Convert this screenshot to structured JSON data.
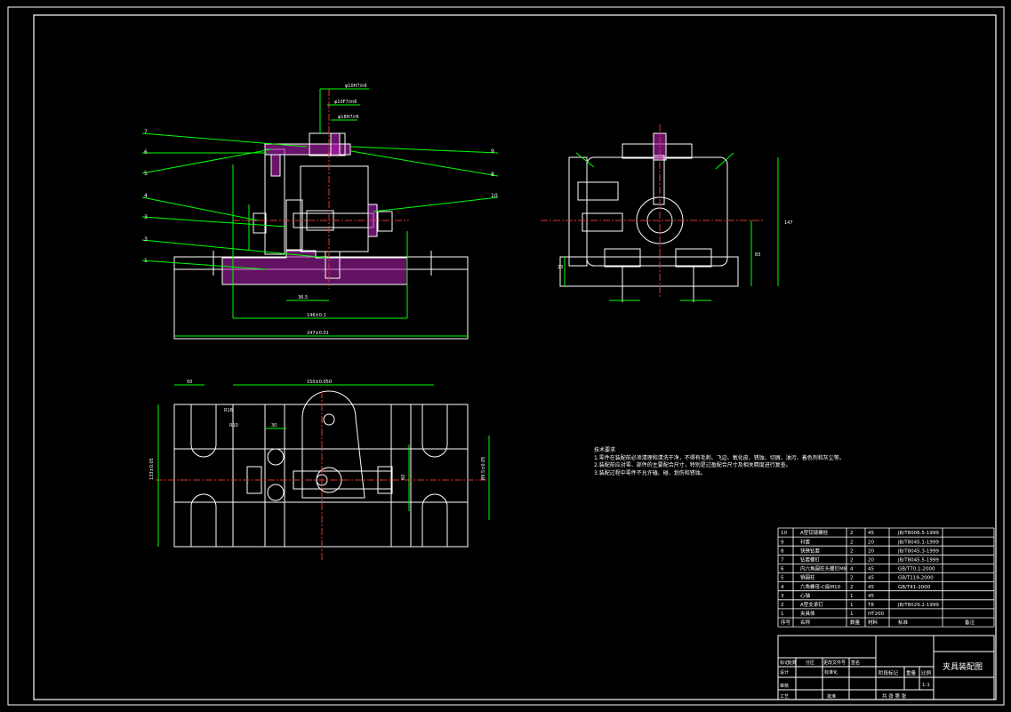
{
  "drawing": {
    "title": "夹具装配图",
    "scale": "1:1",
    "scale_header": "比例",
    "weight_header": "重量",
    "stage_header": "阶段标记",
    "sheet_info": "共 张 第 张",
    "revision_headers": [
      "标记",
      "处数",
      "分区",
      "更改文件号",
      "签名",
      "年月日"
    ],
    "signature_labels": [
      "设计",
      "标准化",
      "审核",
      "工艺",
      "批准"
    ]
  },
  "technical_notes": {
    "heading": "技术要求",
    "lines": [
      "1.零件在装配前必须清理和清洗干净，不得有毛刺、飞边、氧化皮、锈蚀、切屑、油污、着色剂和灰尘等。",
      "2.装配前应对零、部件的主要配合尺寸，特别是过盈配合尺寸及相关精度进行复查。",
      "3.装配过程中零件不允许磕、碰、划伤和锈蚀。"
    ]
  },
  "parts_list": {
    "headers": [
      "序号",
      "名称",
      "数量",
      "材料",
      "标准",
      "备注"
    ],
    "rows": [
      [
        "10",
        "A型铰链螺栓",
        "2",
        "45",
        "JB/T8006.5-1999",
        ""
      ],
      [
        "9",
        "衬套",
        "2",
        "20",
        "JB/T8045.1-1999",
        ""
      ],
      [
        "8",
        "快换钻套",
        "2",
        "20",
        "JB/T8045.3-1999",
        ""
      ],
      [
        "7",
        "钻套螺钉",
        "2",
        "20",
        "JB/T8045.5-1999",
        ""
      ],
      [
        "6",
        "内六角圆柱头螺钉M8",
        "4",
        "45",
        "GB/T70.1-2000",
        ""
      ],
      [
        "5",
        "销圆柱",
        "2",
        "45",
        "GB/T119-2000",
        ""
      ],
      [
        "4",
        "六角螺母-C级M10",
        "2",
        "45",
        "GB/T41-2000",
        ""
      ],
      [
        "3",
        "心轴",
        "1",
        "45",
        "",
        ""
      ],
      [
        "2",
        "A型支承钉",
        "1",
        "T8",
        "JB/T8029.2-1999",
        ""
      ],
      [
        "1",
        "夹具体",
        "1",
        "HT200",
        "",
        ""
      ]
    ]
  },
  "dimensions": {
    "front_view": [
      "247±0.01",
      "146±0.1",
      "φ10H7/n6",
      "φ10F7/m6",
      "φ18H7/r6",
      "36.5"
    ],
    "side_view": [
      "147",
      "83",
      "23"
    ],
    "top_view": [
      "150±0.050",
      "50",
      "R16",
      "R10",
      "30",
      "133±0.05",
      "89.5±0.05",
      "60"
    ]
  },
  "balloon_numbers": [
    "7",
    "6",
    "5",
    "4",
    "3",
    "3",
    "1",
    "9",
    "8",
    "10"
  ]
}
